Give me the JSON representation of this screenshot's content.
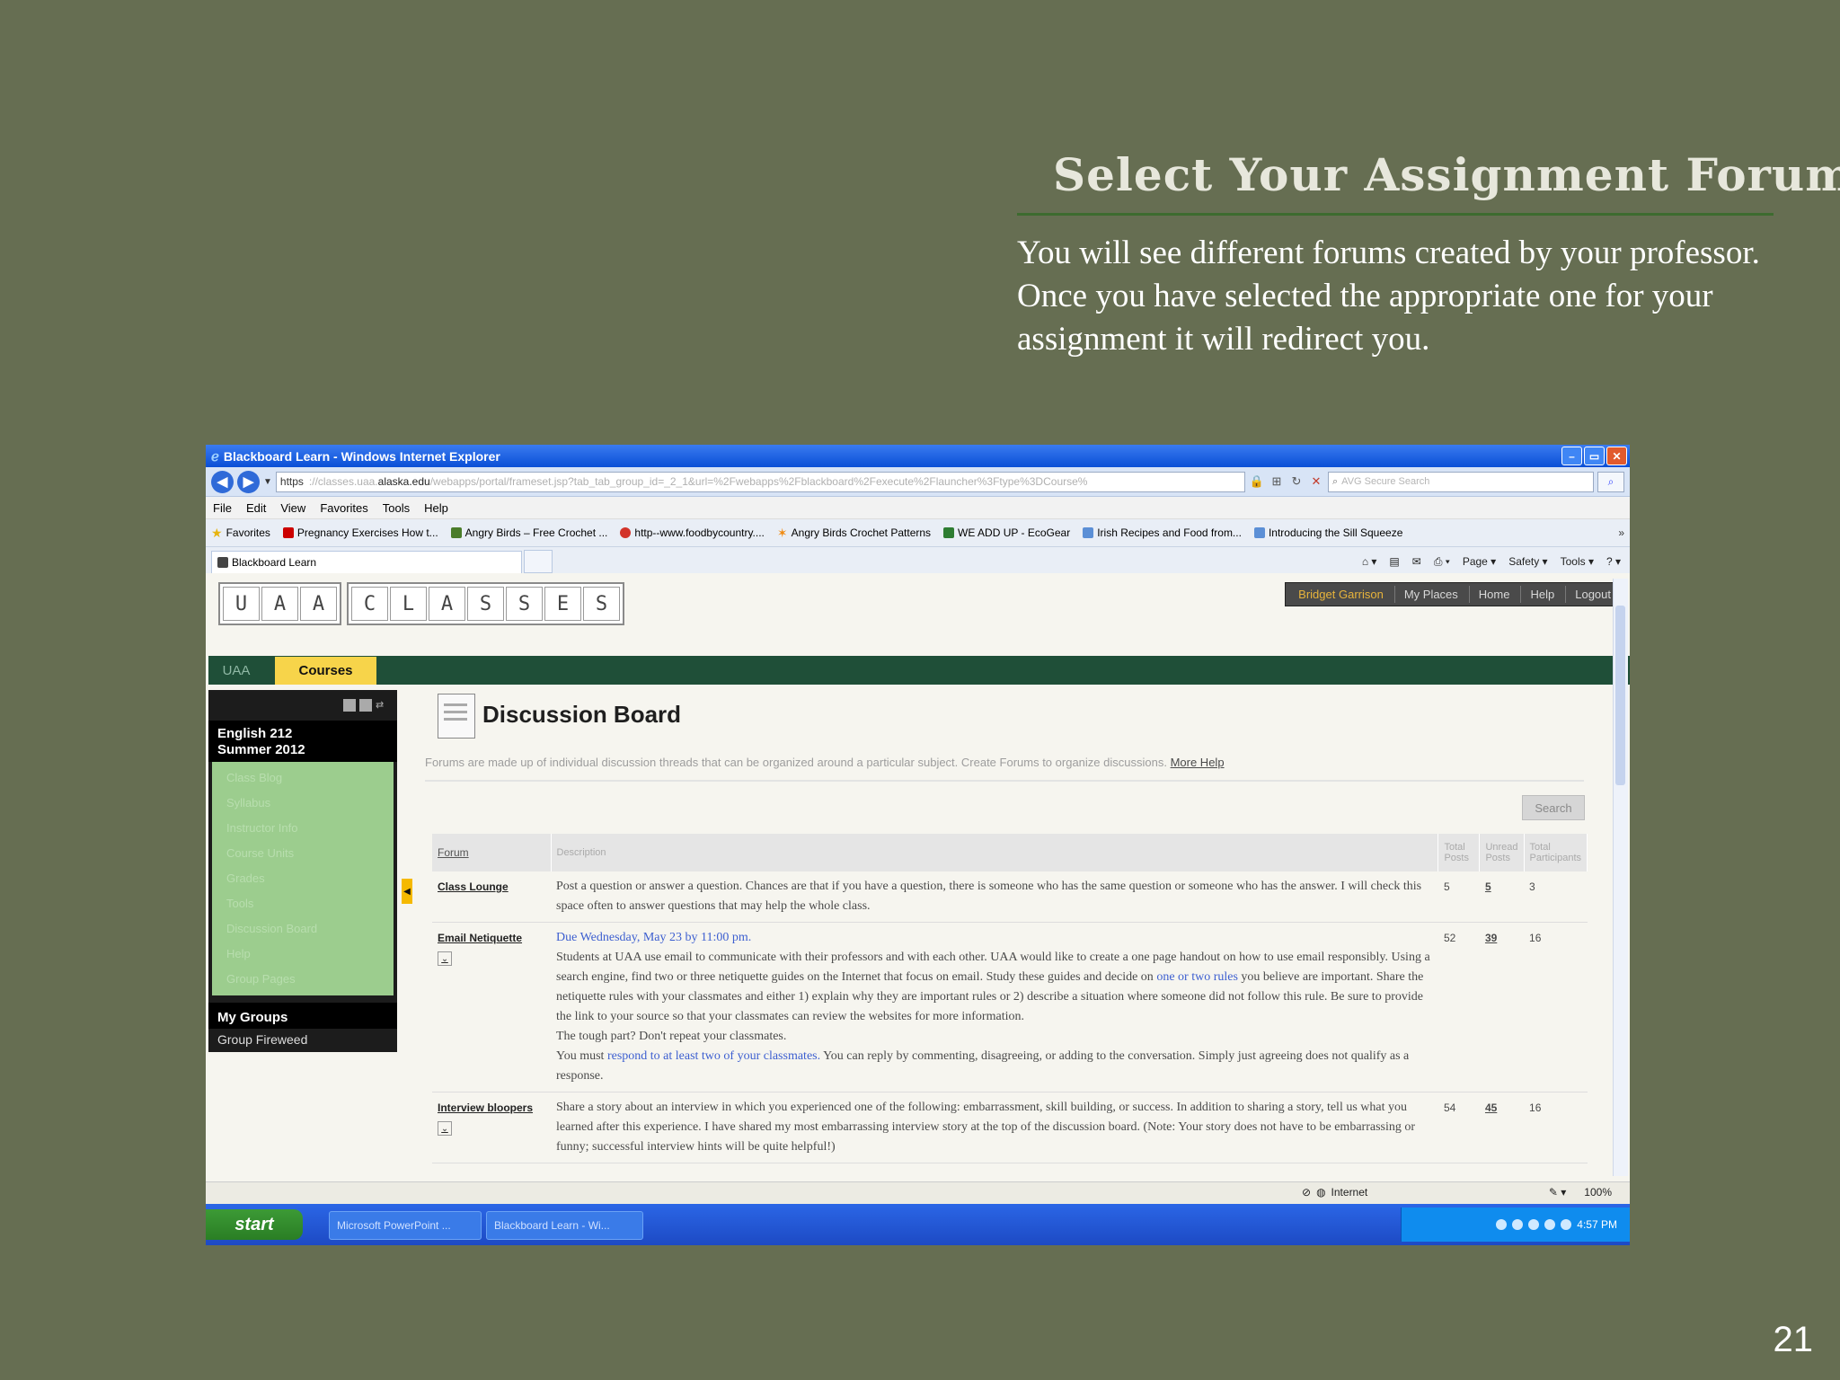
{
  "slide": {
    "title": "Select Your Assignment Forum:",
    "body": "You will see different  forums created by your professor.  Once you have selected the appropriate one for your assignment it will redirect you.",
    "page_number": "21"
  },
  "browser": {
    "window_title": "Blackboard Learn - Windows Internet Explorer",
    "url_scheme": "https",
    "url_host_prefix": "://classes.uaa.",
    "url_host": "alaska.edu",
    "url_path": "/webapps/portal/frameset.jsp?tab_tab_group_id=_2_1&url=%2Fwebapps%2Fblackboard%2Fexecute%2Flauncher%3Ftype%3DCourse%",
    "search_placeholder": "AVG Secure Search",
    "menu": [
      "File",
      "Edit",
      "View",
      "Favorites",
      "Tools",
      "Help"
    ],
    "favorites_label": "Favorites",
    "favorites": [
      "Pregnancy Exercises How t...",
      "Angry Birds – Free Crochet ...",
      "http--www.foodbycountry....",
      "Angry Birds Crochet Patterns",
      "WE ADD UP - EcoGear",
      "Irish Recipes and Food from...",
      "Introducing the Sill Squeeze"
    ],
    "tab_label": "Blackboard Learn",
    "commands": [
      "Page ▾",
      "Safety ▾",
      "Tools ▾"
    ]
  },
  "bb": {
    "logo_group1": [
      "U",
      "A",
      "A"
    ],
    "logo_group2": [
      "C",
      "L",
      "A",
      "S",
      "S",
      "E",
      "S"
    ],
    "user_name": "Bridget Garrison",
    "topnav": [
      "My Places",
      "Home",
      "Help",
      "Logout"
    ],
    "tab_uaa": "UAA",
    "tab_courses": "Courses",
    "course_title_line1": "English 212",
    "course_title_line2": "Summer 2012",
    "course_links": [
      "Class Blog",
      "Syllabus",
      "Instructor Info",
      "Course Units",
      "Grades",
      "Tools",
      "Discussion Board",
      "Help",
      "Group Pages"
    ],
    "groups_header": "My Groups",
    "group_item": "Group Fireweed",
    "page_title": "Discussion Board",
    "page_desc": "Forums are made up of individual discussion threads that can be organized around a particular subject. Create Forums to organize discussions.",
    "more_help": "More Help",
    "search_button": "Search",
    "table_headers": {
      "forum": "Forum",
      "description": "Description",
      "total_posts": "Total Posts",
      "unread_posts": "Unread Posts",
      "total_participants": "Total Participants"
    },
    "forums": [
      {
        "name": "Class Lounge",
        "description": "Post a question or answer a question. Chances are that if you have a question, there is someone who has the same question or someone who has the answer. I will check this space often to answer questions that may help the whole class.",
        "total_posts": "5",
        "unread_posts": "5",
        "participants": "3"
      },
      {
        "name": "Email Netiquette",
        "due": "Due Wednesday, May 23 by 11:00 pm.",
        "description_a": "Students at UAA use email to communicate with their professors and with each other. UAA would like to create a one page handout on how to use email responsibly. Using a search engine, find two or three netiquette guides on the Internet that focus on email. Study these guides and decide on",
        "description_link1": "one or two rules",
        "description_b": "you believe are important. Share the netiquette rules with your classmates and either 1) explain why they are important rules or 2) describe a situation where someone did not follow this rule. Be sure to provide the link to your source so that your classmates can review the websites for more information.",
        "description_c": "The tough part? Don't repeat your classmates.",
        "description_d": "You must",
        "description_link2": "respond to at least two of your classmates.",
        "description_e": "You can reply by commenting, disagreeing, or adding to the conversation. Simply just agreeing does not qualify as a response.",
        "total_posts": "52",
        "unread_posts": "39",
        "participants": "16"
      },
      {
        "name": "Interview bloopers",
        "description": "Share a story about an interview in which you experienced one of the following: embarrassment, skill building, or success. In addition to sharing a story, tell us what you learned after this experience. I have shared my most embarrassing interview story at the top of the discussion board. (Note: Your story does not have to be embarrassing or funny; successful interview hints will be quite helpful!)",
        "total_posts": "54",
        "unread_posts": "45",
        "participants": "16"
      }
    ]
  },
  "status": {
    "zone": "Internet",
    "zoom": "100%"
  },
  "taskbar": {
    "start": "start",
    "items": [
      "Microsoft PowerPoint ...",
      "Blackboard Learn - Wi..."
    ],
    "clock": "4:57 PM"
  }
}
